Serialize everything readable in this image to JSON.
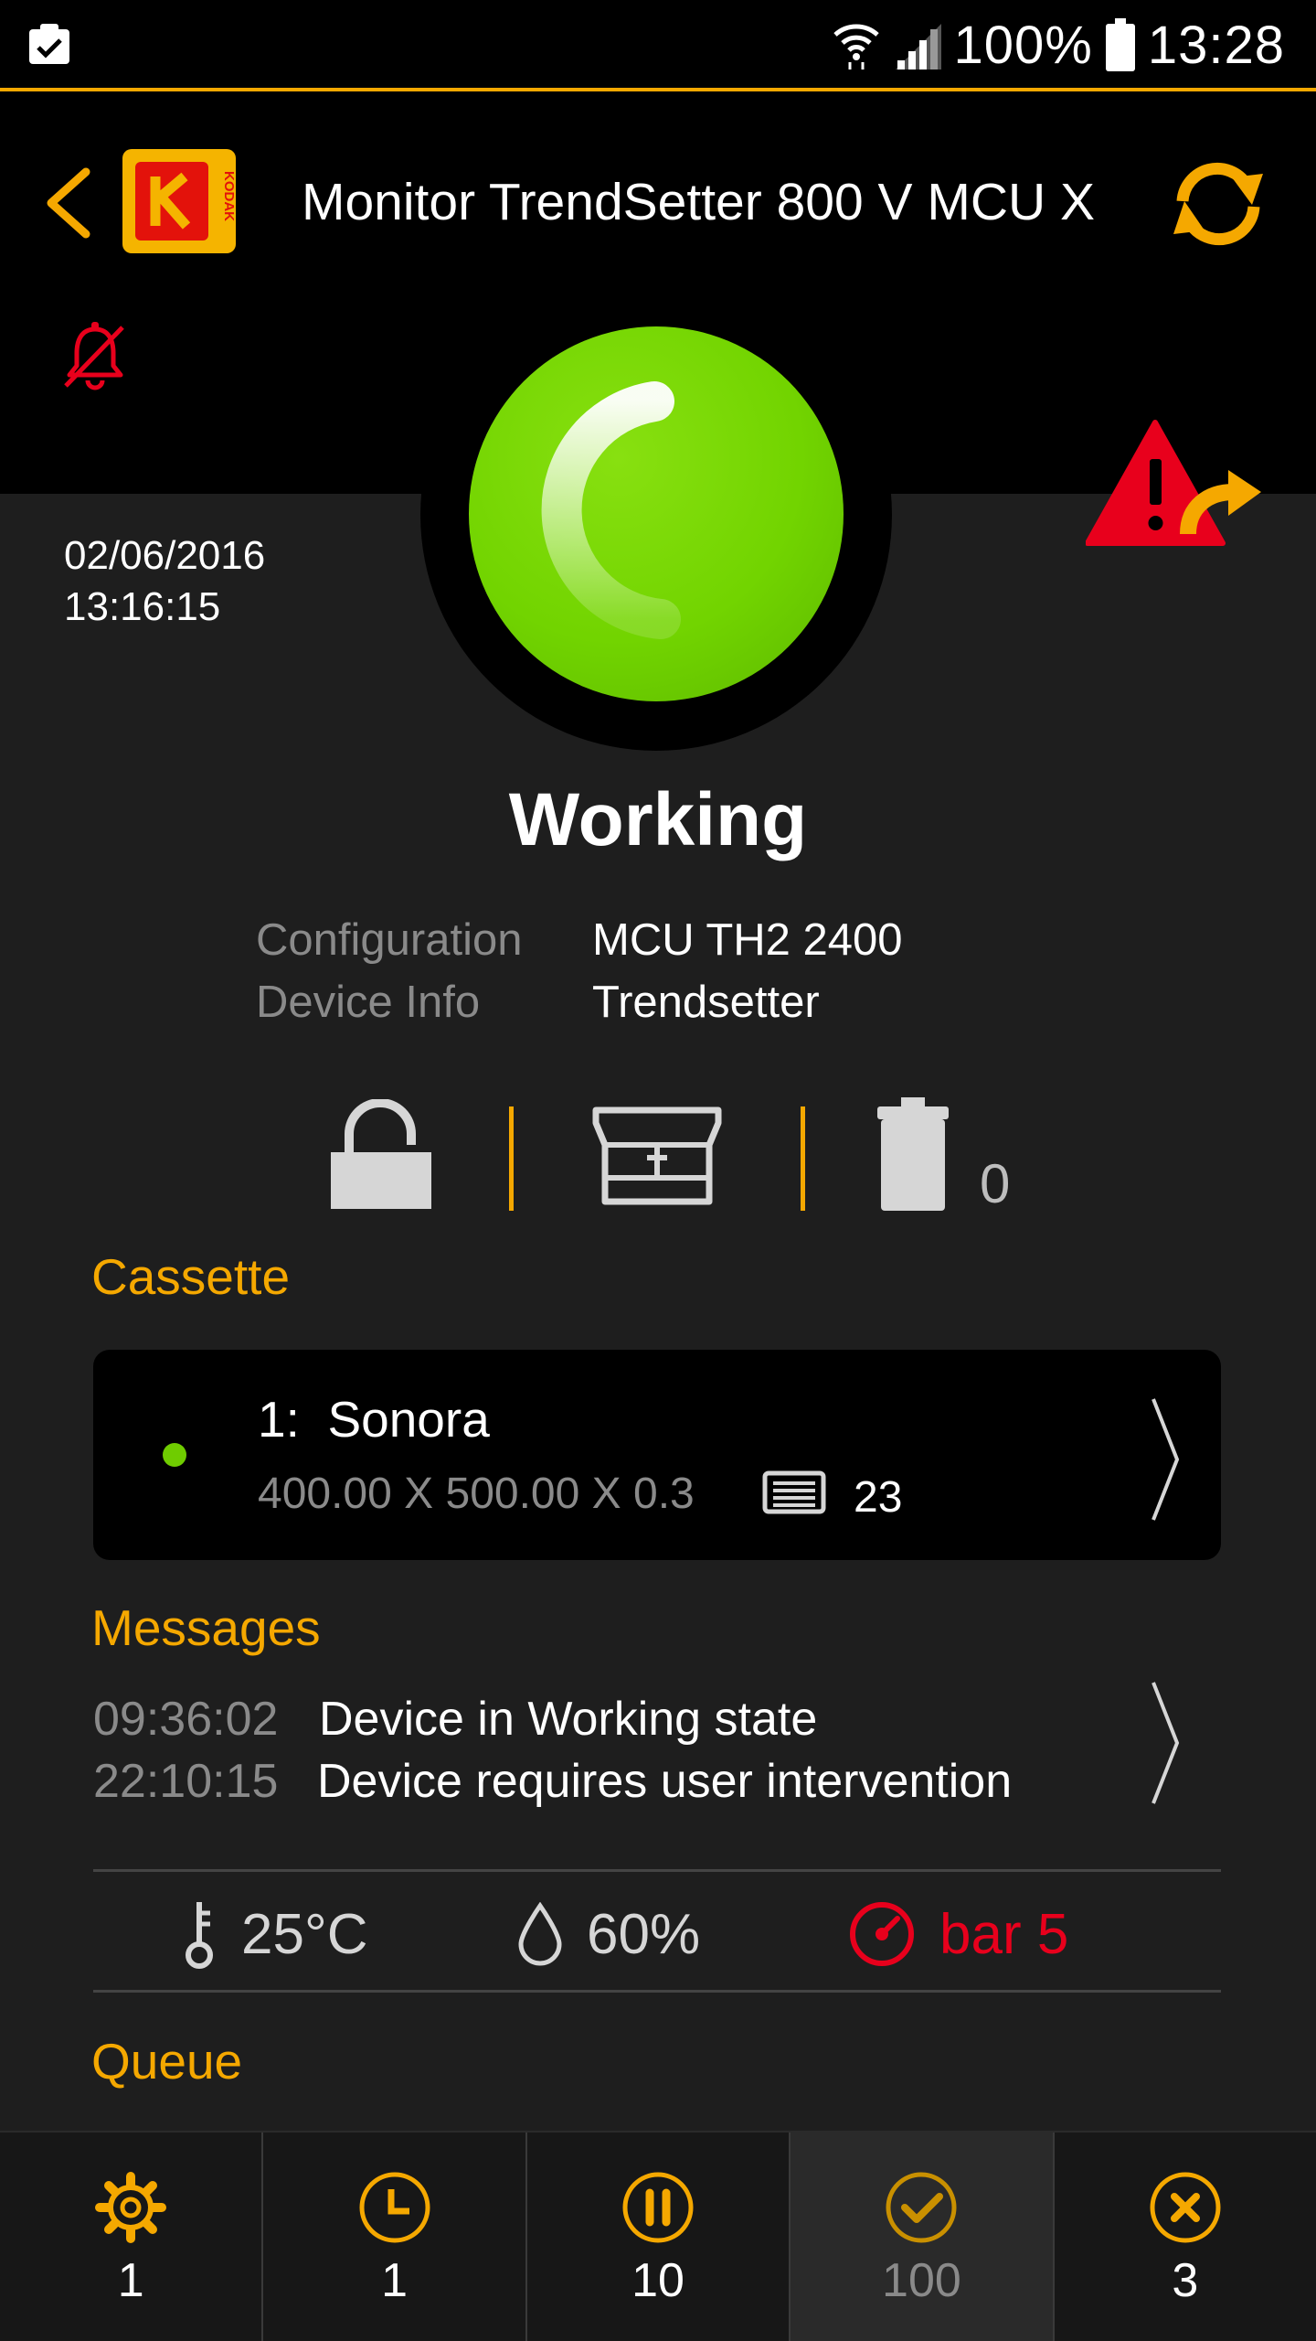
{
  "status_bar": {
    "battery": "100%",
    "time": "13:28"
  },
  "header": {
    "title": "Monitor TrendSetter 800 V MCU X",
    "logo_text": "KODAK"
  },
  "colors": {
    "accent": "#f5a800",
    "status_ok": "#72d400",
    "alert": "#e8001c"
  },
  "status": {
    "state": "Working",
    "date": "02/06/2016",
    "time": "13:16:15"
  },
  "info": {
    "configuration_label": "Configuration",
    "configuration_value": "MCU TH2 2400",
    "device_info_label": "Device Info",
    "device_info_value": "Trendsetter"
  },
  "device": {
    "bin_count": "0"
  },
  "cassette": {
    "section_title": "Cassette",
    "index": "1:",
    "name": "Sonora",
    "dimensions": "400.00 X 500.00 X 0.3",
    "plate_count": "23"
  },
  "messages": {
    "section_title": "Messages",
    "items": [
      {
        "time": "09:36:02",
        "text": "Device in Working state"
      },
      {
        "time": "22:10:15",
        "text": "Device requires user intervention"
      }
    ]
  },
  "environment": {
    "temperature": "25°C",
    "humidity": "60%",
    "pressure": "bar 5"
  },
  "queue": {
    "section_title": "Queue"
  },
  "tabs": [
    {
      "icon": "gear-icon",
      "count": "1"
    },
    {
      "icon": "clock-icon",
      "count": "1"
    },
    {
      "icon": "pause-icon",
      "count": "10"
    },
    {
      "icon": "check-icon",
      "count": "100"
    },
    {
      "icon": "close-icon",
      "count": "3"
    }
  ]
}
